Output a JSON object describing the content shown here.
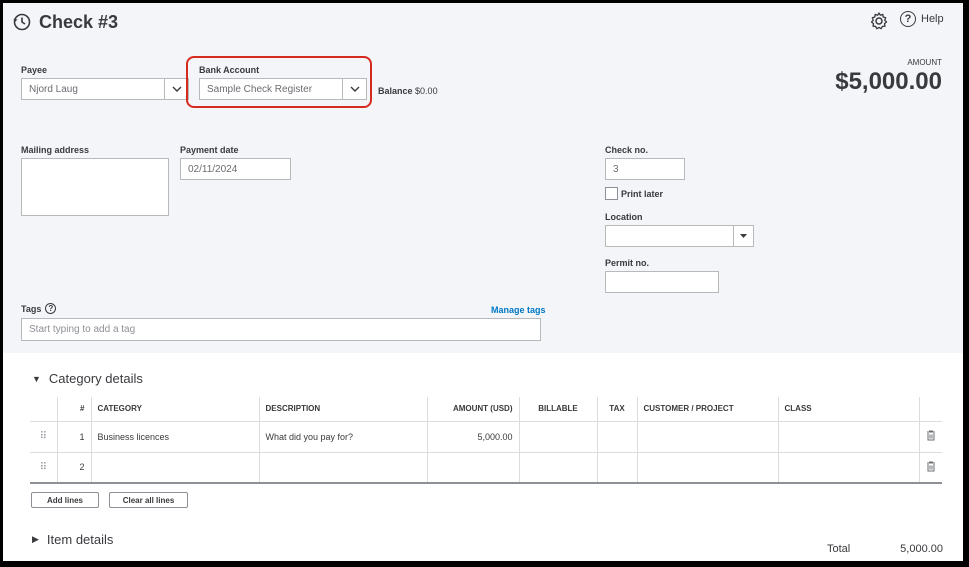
{
  "header": {
    "title": "Check #3",
    "help_label": "Help"
  },
  "payee": {
    "label": "Payee",
    "value": "Njord Laug"
  },
  "bank_account": {
    "label": "Bank Account",
    "value": "Sample Check Register"
  },
  "balance": {
    "label": "Balance",
    "value": "$0.00"
  },
  "amount": {
    "label": "AMOUNT",
    "value": "$5,000.00"
  },
  "mailing_address": {
    "label": "Mailing address",
    "value": ""
  },
  "payment_date": {
    "label": "Payment date",
    "value": "02/11/2024"
  },
  "check_no": {
    "label": "Check no.",
    "value": "3"
  },
  "print_later": {
    "label": "Print later",
    "checked": false
  },
  "location": {
    "label": "Location",
    "value": ""
  },
  "permit_no": {
    "label": "Permit no.",
    "value": ""
  },
  "tags": {
    "label": "Tags",
    "manage_label": "Manage tags",
    "placeholder": "Start typing to add a tag"
  },
  "category_details": {
    "title": "Category details",
    "columns": [
      "#",
      "CATEGORY",
      "DESCRIPTION",
      "AMOUNT (USD)",
      "BILLABLE",
      "TAX",
      "CUSTOMER / PROJECT",
      "CLASS"
    ],
    "rows": [
      {
        "num": "1",
        "category": "Business licences",
        "description_placeholder": "What did you pay for?",
        "amount": "5,000.00"
      },
      {
        "num": "2",
        "category": "",
        "description_placeholder": "",
        "amount": ""
      }
    ],
    "add_lines_label": "Add lines",
    "clear_lines_label": "Clear all lines"
  },
  "item_details": {
    "title": "Item details"
  },
  "total": {
    "label": "Total",
    "value": "5,000.00"
  }
}
